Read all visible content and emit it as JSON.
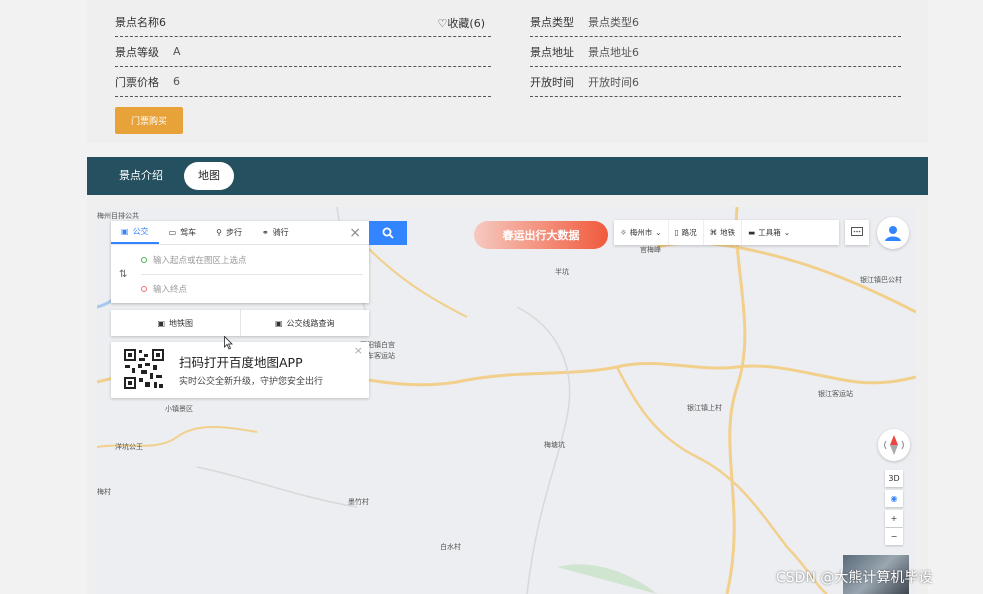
{
  "info": {
    "name": "景点名称6",
    "favorite": "收藏(6)",
    "type_label": "景点类型",
    "type_value": "景点类型6",
    "level_label": "景点等级",
    "level_value": "A",
    "address_label": "景点地址",
    "address_value": "景点地址6",
    "price_label": "门票价格",
    "price_value": "6",
    "open_label": "开放时间",
    "open_value": "开放时间6",
    "buy_button": "门票购买"
  },
  "tabs": {
    "intro": "景点介绍",
    "map": "地图"
  },
  "map": {
    "route_tabs": {
      "bus": "公交",
      "drive": "驾车",
      "walk": "步行",
      "ride": "骑行"
    },
    "start_placeholder": "输入起点或在图区上选点",
    "end_placeholder": "输入终点",
    "subway_map": "地铁图",
    "bus_route_query": "公交线路查询",
    "qr_title": "扫码打开百度地图APP",
    "qr_subtitle": "实时公交全新升级，守护您安全出行",
    "banner": "春运出行大数据",
    "toolbar": {
      "city": "梅州市",
      "traffic": "路况",
      "subway": "地铁",
      "tools": "工具箱"
    },
    "controls": {
      "three_d": "3D",
      "zoom_in": "+",
      "zoom_out": "−"
    },
    "places": {
      "bus_stop_top": "梅州目排公共",
      "banjing": "半坑",
      "yinjiang_bus": "银江镇巴公村",
      "baiyang": "百阳镇白宫",
      "bus_station": "车客运站",
      "scenic_area": "小镇景区",
      "yinjiang_up": "银江镇上村",
      "yinjiang_station": "银江客运站",
      "banggang": "梅塘坑",
      "west_village": "洋坑公王",
      "bamboo_village": "墨竹村",
      "white_water": "白水村",
      "guan_mei": "官梅峰",
      "left_village": "梅村"
    },
    "watermark": "CSDN @大熊计算机毕设"
  }
}
